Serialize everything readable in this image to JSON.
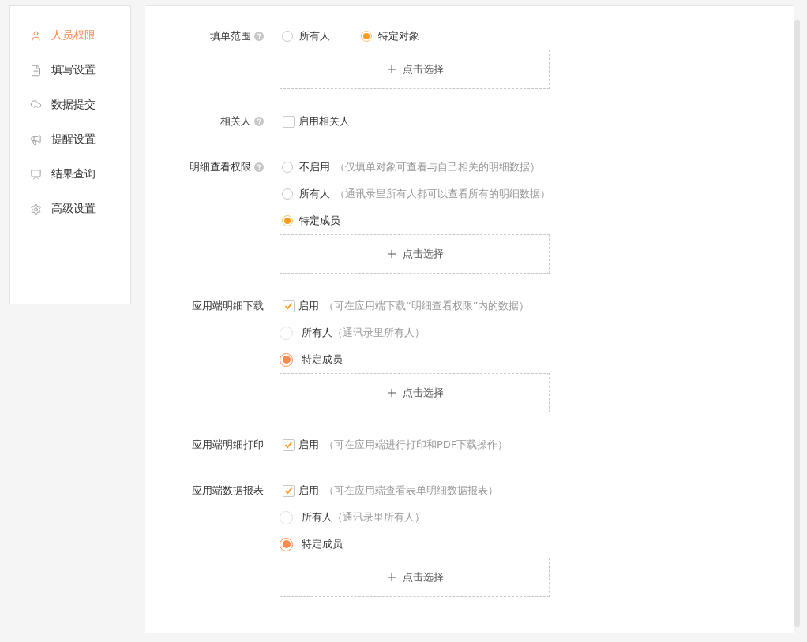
{
  "sidebar": {
    "items": [
      {
        "label": "人员权限",
        "selected": true
      },
      {
        "label": "填写设置",
        "selected": false
      },
      {
        "label": "数据提交",
        "selected": false
      },
      {
        "label": "提醒设置",
        "selected": false
      },
      {
        "label": "结果查询",
        "selected": false
      },
      {
        "label": "高级设置",
        "selected": false
      }
    ]
  },
  "sections": [
    {
      "label": "填单范围",
      "help": true,
      "items": [
        {
          "kind": "radio-group",
          "options": [
            {
              "label": "所有人",
              "selected": false
            },
            {
              "label": "特定对象",
              "selected": true
            }
          ]
        },
        {
          "kind": "picker",
          "label": "点击选择"
        }
      ]
    },
    {
      "label": "相关人",
      "help": true,
      "items": [
        {
          "kind": "checkbox",
          "label": "启用相关人",
          "checked": false
        }
      ]
    },
    {
      "label": "明细查看权限",
      "help": true,
      "items": [
        {
          "kind": "radio",
          "label": "不启用",
          "hint": "（仅填单对象可查看与自己相关的明细数据）",
          "selected": false
        },
        {
          "kind": "radio",
          "label": "所有人",
          "hint": "（通讯录里所有人都可以查看所有的明细数据）",
          "selected": false
        },
        {
          "kind": "radio",
          "label": "特定成员",
          "selected": true
        },
        {
          "kind": "picker",
          "label": "点击选择"
        }
      ]
    },
    {
      "label": "应用端明细下载",
      "help": false,
      "items": [
        {
          "kind": "checkbox",
          "label": "启用",
          "hint": "（可在应用端下载“明细查看权限”内的数据）",
          "checked": true
        },
        {
          "kind": "radio-soft",
          "label": "所有人",
          "hint": "（通讯录里所有人）",
          "selected": false
        },
        {
          "kind": "radio-soft",
          "label": "特定成员",
          "selected": true
        },
        {
          "kind": "picker",
          "label": "点击选择"
        }
      ]
    },
    {
      "label": "应用端明细打印",
      "help": false,
      "items": [
        {
          "kind": "checkbox",
          "label": "启用",
          "hint": "（可在应用端进行打印和PDF下载操作）",
          "checked": true
        }
      ]
    },
    {
      "label": "应用端数据报表",
      "help": false,
      "items": [
        {
          "kind": "checkbox",
          "label": "启用",
          "hint": "（可在应用端查看表单明细数据报表）",
          "checked": true
        },
        {
          "kind": "radio-soft",
          "label": "所有人",
          "hint": "（通讯录里所有人）",
          "selected": false
        },
        {
          "kind": "radio-soft",
          "label": "特定成员",
          "selected": true
        },
        {
          "kind": "picker",
          "label": "点击选择"
        }
      ]
    }
  ]
}
